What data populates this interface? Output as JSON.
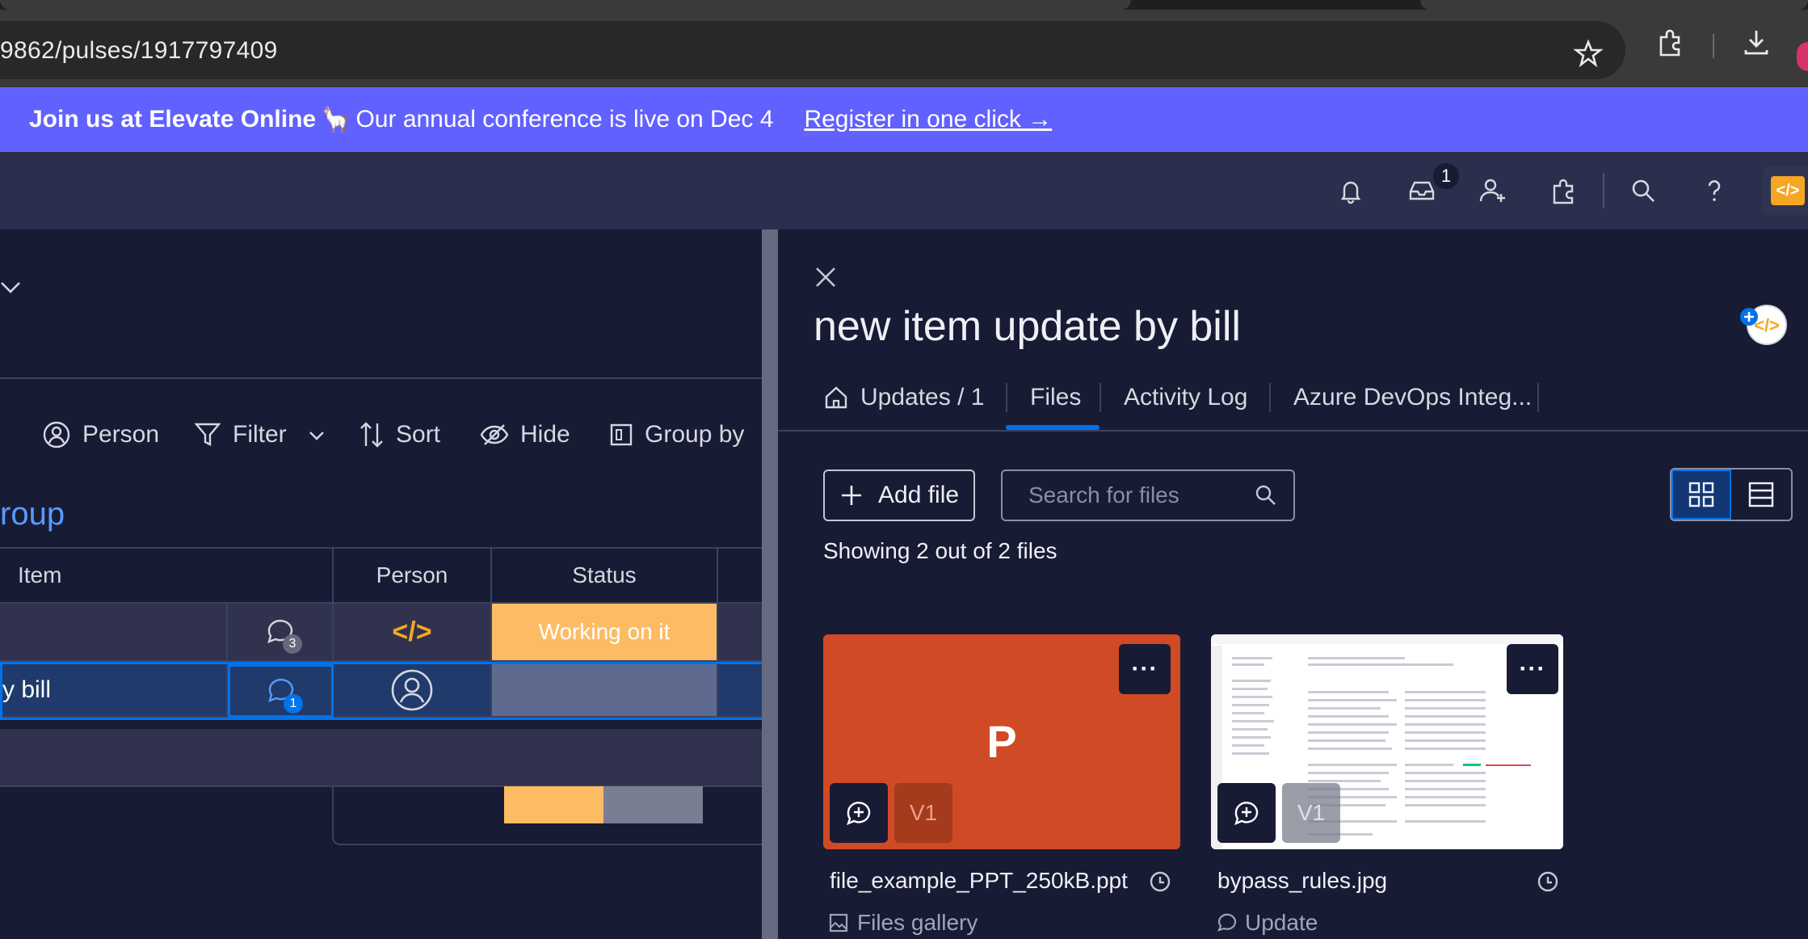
{
  "browser": {
    "url": "9862/pulses/1917797409",
    "icons": [
      "star-icon",
      "extensions-icon",
      "download-icon"
    ]
  },
  "banner": {
    "strong": "Join us at Elevate Online",
    "emoji": "🦙",
    "text": "Our annual conference is live on Dec 4",
    "link": "Register in one click →",
    "color": "#6161ff"
  },
  "topbar": {
    "inbox_badge": "1",
    "dev_label": "</>"
  },
  "board": {
    "toolbar": {
      "person": "Person",
      "filter": "Filter",
      "sort": "Sort",
      "hide": "Hide",
      "group_by": "Group by"
    },
    "group_title": "roup",
    "columns": {
      "item": "Item",
      "person": "Person",
      "status": "Status"
    },
    "rows": [
      {
        "item": "",
        "updates": "3",
        "person": "</>",
        "status": "Working on it"
      },
      {
        "item": "y bill",
        "updates": "1",
        "person": "",
        "status": ""
      }
    ],
    "status_summary": {
      "working_fraction": 0.5,
      "colors": [
        "#fdbc64",
        "#797e93"
      ]
    }
  },
  "panel": {
    "title": "new item update by bill",
    "tabs": [
      {
        "label": "Updates / 1"
      },
      {
        "label": "Files"
      },
      {
        "label": "Activity Log"
      },
      {
        "label": "Azure DevOps Integ..."
      }
    ],
    "active_tab": "Files",
    "add_file": "Add file",
    "search_placeholder": "Search for files",
    "showing": "Showing 2 out of 2 files",
    "files": [
      {
        "letter": "P",
        "version": "V1",
        "name": "file_example_PPT_250kB.ppt",
        "source": "Files gallery",
        "menu": "···"
      },
      {
        "letter": "",
        "version": "V1",
        "name": "bypass_rules.jpg",
        "source": "Update",
        "menu": "···"
      }
    ],
    "accent": "#0073ea"
  }
}
